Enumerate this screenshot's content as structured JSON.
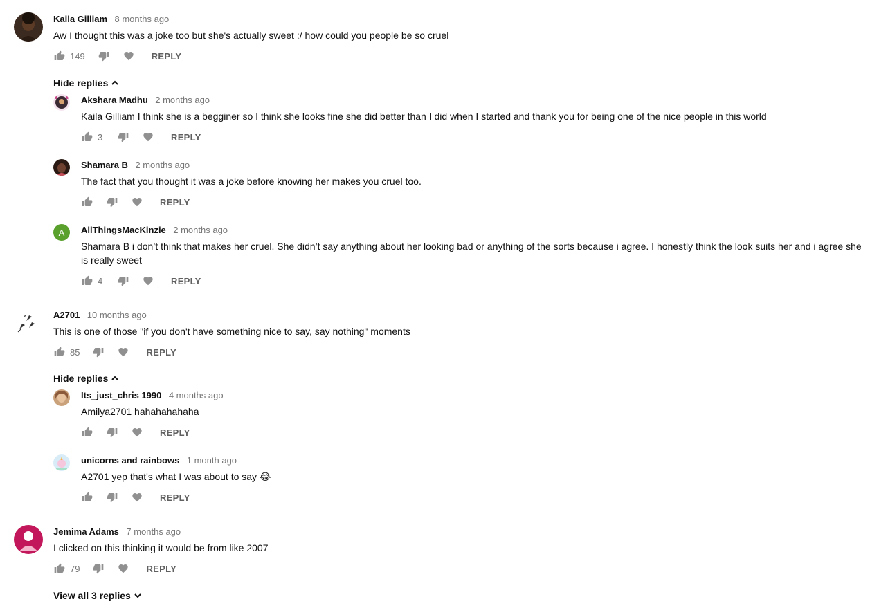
{
  "actions": {
    "reply_label": "REPLY"
  },
  "threads": [
    {
      "author": "Kaila Gilliam",
      "time": "8 months ago",
      "text": "Aw I thought this was a joke too but she's actually sweet :/ how could you people be so cruel",
      "likes": "149",
      "toggle_label": "Hide replies",
      "replies": [
        {
          "author": "Akshara Madhu",
          "time": "2 months ago",
          "text": "Kaila Gilliam I think she is a begginer so I think she looks fine she did better than I did when I started and thank you for being one of the nice people in this world",
          "likes": "3"
        },
        {
          "author": "Shamara B",
          "time": "2 months ago",
          "text": "The fact that you thought it was a joke before knowing her makes you cruel too.",
          "likes": ""
        },
        {
          "author": "AllThingsMacKinzie",
          "avatar_letter": "A",
          "time": "2 months ago",
          "text": "Shamara B i don’t think that makes her cruel. She didn’t say anything about her looking bad or anything of the sorts because i agree. I honestly think the look suits her and i agree she is really sweet",
          "likes": "4"
        }
      ]
    },
    {
      "author": "A2701",
      "time": "10 months ago",
      "text": "This is one of those \"if you don't have something nice to say, say nothing\" moments",
      "likes": "85",
      "toggle_label": "Hide replies",
      "replies": [
        {
          "author": "Its_just_chris 1990",
          "time": "4 months ago",
          "text": "Amilya2701 hahahahahaha",
          "likes": ""
        },
        {
          "author": "unicorns and rainbows",
          "time": "1 month ago",
          "text": "A2701 yep that's what I was about to say 😂",
          "likes": ""
        }
      ]
    },
    {
      "author": "Jemima Adams",
      "time": "7 months ago",
      "text": "I clicked on this thinking it would be from like 2007",
      "likes": "79",
      "toggle_label": "View all 3 replies"
    }
  ],
  "colors": {
    "text": "#111111",
    "muted": "#767676",
    "icon": "#909090",
    "avatar_green": "#5aa02c",
    "avatar_pink": "#c2185b"
  }
}
